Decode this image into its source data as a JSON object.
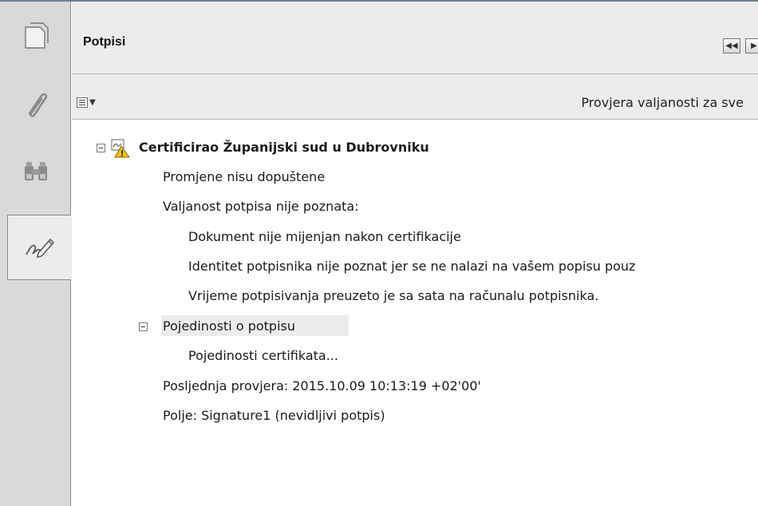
{
  "panel": {
    "title": "Potpisi",
    "nav_prev_icon": "double-left-arrow-icon",
    "nav_next_icon": "right-arrow-icon"
  },
  "toolbar": {
    "options_icon": "options-menu-icon",
    "validate_all_label": "Provjera valjanosti za sve"
  },
  "tabs": [
    {
      "name": "pages",
      "icon": "pages-icon"
    },
    {
      "name": "attachments",
      "icon": "paperclip-icon"
    },
    {
      "name": "search",
      "icon": "binoculars-icon"
    },
    {
      "name": "signatures",
      "icon": "signature-pen-icon",
      "active": true
    }
  ],
  "signature": {
    "title": "Certificirao Županijski sud u Dubrovniku",
    "status_icon": "certified-warning-icon",
    "changes": "Promjene nisu dopuštene",
    "validity": "Valjanost potpisa nije poznata:",
    "validity_details": [
      "Dokument nije mijenjan nakon certifikacije",
      "Identitet potpisnika nije poznat jer se ne nalazi na vašem popisu pouz",
      "Vrijeme potpisivanja preuzeto je sa sata na računalu potpisnika."
    ],
    "details_label": "Pojedinosti o potpisu",
    "certificate_details": "Pojedinosti certifikata...",
    "last_check": "Posljednja provjera: 2015.10.09 10:13:19 +02'00'",
    "field": "Polje: Signature1 (nevidljivi potpis)"
  }
}
